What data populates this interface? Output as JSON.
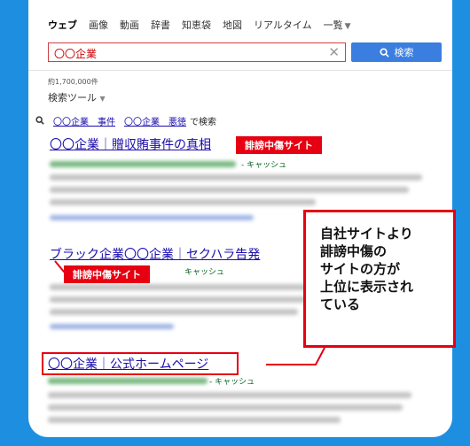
{
  "tabs": [
    {
      "label": "ウェブ",
      "active": true
    },
    {
      "label": "画像",
      "active": false
    },
    {
      "label": "動画",
      "active": false
    },
    {
      "label": "辞書",
      "active": false
    },
    {
      "label": "知恵袋",
      "active": false
    },
    {
      "label": "地図",
      "active": false
    },
    {
      "label": "リアルタイム",
      "active": false
    },
    {
      "label": "一覧",
      "active": false
    }
  ],
  "search": {
    "value": "〇〇企業",
    "button_label": "検索"
  },
  "result_count": "約1,700,000件",
  "search_tools": "検索ツール",
  "related": {
    "link1": "〇〇企業　事件",
    "link2": "〇〇企業　悪徳",
    "suffix": "で検索"
  },
  "results": [
    {
      "title": "〇〇企業｜贈収賄事件の真相",
      "cache": "- キャッシュ"
    },
    {
      "title": "ブラック企業〇〇企業｜セクハラ告発",
      "cache": "キャッシュ"
    },
    {
      "title": "〇〇企業｜公式ホームページ",
      "cache": "- キャッシュ"
    }
  ],
  "annotations": {
    "tag1": "誹謗中傷サイト",
    "tag2": "誹謗中傷サイト",
    "callout_lines": [
      "自社サイトより",
      "誹謗中傷の",
      "サイトの方が",
      "上位に表示され",
      "ている"
    ]
  },
  "colors": {
    "background": "#1e8fe0",
    "accent_red": "#e60012",
    "link": "#1a0dab",
    "search_button": "#3a7ee0"
  }
}
